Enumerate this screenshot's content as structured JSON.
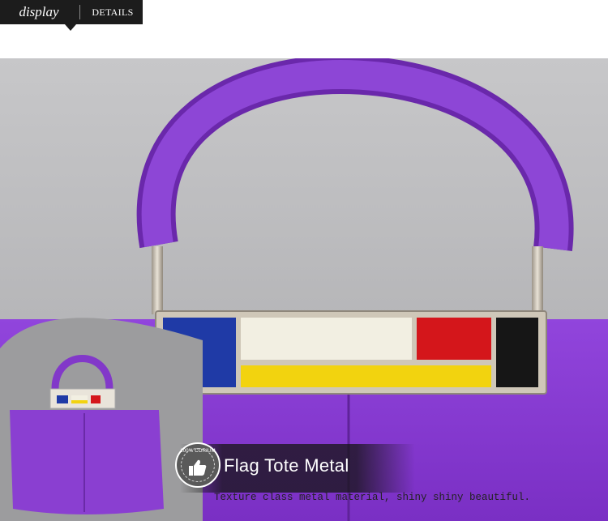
{
  "header": {
    "tab_display": "display",
    "tab_details": "DETAILS"
  },
  "photo": {
    "bag_color": "#8a3fd1",
    "strap_color": "#7e35c3",
    "plate_colors": [
      "#1f3aa6",
      "#f2efe2",
      "#d4161b",
      "#161616",
      "#f2d30f"
    ]
  },
  "badge": {
    "text": "100% CORIUM",
    "icon": "thumbs-up-icon"
  },
  "caption": {
    "title": "Flag Tote Metal",
    "description": "Texture class metal material, shiny shiny beautiful."
  }
}
